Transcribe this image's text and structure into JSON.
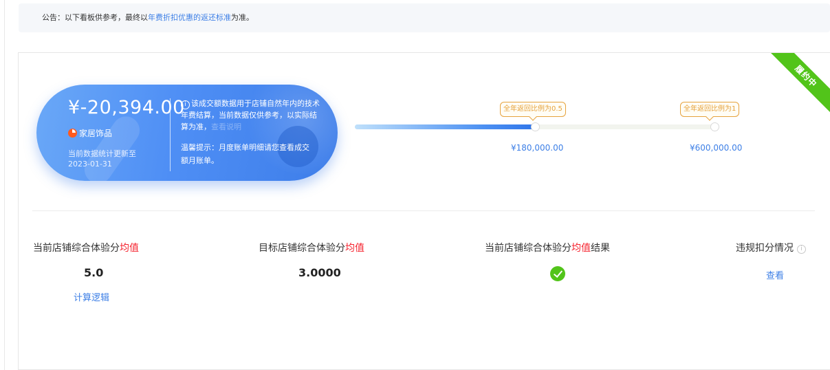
{
  "notice": {
    "prefix": "公告：以下看板供参考，最终以",
    "link": "年费折扣优惠的返还标准",
    "suffix": "为准。"
  },
  "status_ribbon": "履约中",
  "summary": {
    "amount": "¥-20,394.00",
    "category_icon": "category-pie-icon",
    "category": "家居饰品",
    "update_line1": "当前数据统计更新至",
    "update_date": "2023-01-31",
    "info_icon": "info-icon",
    "desc_main": "该成交额数据用于店铺自然年内的技术年费结算，当前数据仅供参考，以实际结算为准，",
    "desc_faded": "查看说明",
    "tip": "温馨提示：月度账单明细请您查看成交额月账单。"
  },
  "progress": {
    "fill_fraction": 0.51,
    "milestones": [
      {
        "tag": "全年返回比例为0.5",
        "amount": "¥180,000.00"
      },
      {
        "tag": "全年返回比例为1",
        "amount": "¥600,000.00"
      }
    ]
  },
  "metrics": {
    "current_label": "当前店铺综合体验分",
    "current_label_hl": "均值",
    "current_value": "5.0",
    "calc_link": "计算逻辑",
    "target_label": "目标店铺综合体验分",
    "target_label_hl": "均值",
    "target_value": "3.0000",
    "result_label_a": "当前店铺综合体验分",
    "result_label_hl": "均值",
    "result_label_b": "结果",
    "result_icon": "check-circle-icon",
    "violation_label": "违规扣分情况",
    "violation_icon": "question-icon",
    "violation_link": "查看"
  },
  "colors": {
    "accent_blue": "#3d7fe6",
    "highlight_red": "#f5222d",
    "success_green": "#52c41a",
    "tag_orange": "#e6a23c"
  }
}
